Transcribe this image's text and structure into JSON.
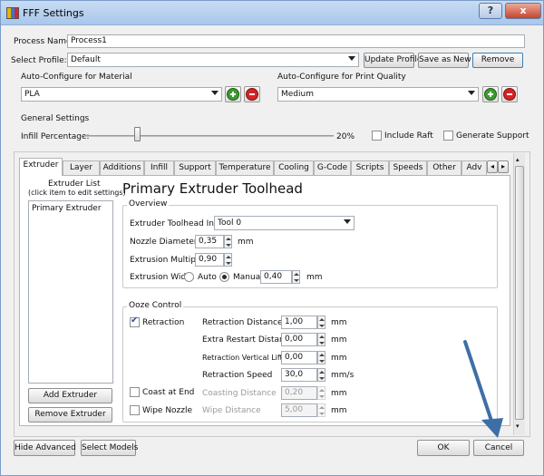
{
  "window": {
    "title": "FFF Settings",
    "help_label": "?",
    "close_label": "x"
  },
  "process_name_label": "Process Name:",
  "process_name_value": "Process1",
  "select_profile_label": "Select Profile:",
  "select_profile_value": "Default",
  "update_profile_label": "Update Profile",
  "save_as_new_label": "Save as New",
  "remove_label": "Remove",
  "auto_material_label": "Auto-Configure for Material",
  "auto_material_value": "PLA",
  "auto_quality_label": "Auto-Configure for Print Quality",
  "auto_quality_value": "Medium",
  "general_settings_label": "General Settings",
  "infill_percentage_label": "Infill Percentage:",
  "infill_percentage_value": "20%",
  "infill_percentage_fraction": 0.2,
  "include_raft_label": "Include Raft",
  "generate_support_label": "Generate Support",
  "tabs": [
    "Extruder",
    "Layer",
    "Additions",
    "Infill",
    "Support",
    "Temperature",
    "Cooling",
    "G-Code",
    "Scripts",
    "Speeds",
    "Other",
    "Adv"
  ],
  "active_tab": "Extruder",
  "extruder_list": {
    "title_line1": "Extruder List",
    "title_line2": "(click item to edit settings)",
    "items": [
      "Primary Extruder"
    ]
  },
  "add_extruder_label": "Add Extruder",
  "remove_extruder_label": "Remove Extruder",
  "panel_title": "Primary Extruder Toolhead",
  "overview": {
    "title": "Overview",
    "toolhead_index_label": "Extruder Toolhead Index",
    "toolhead_index_value": "Tool 0",
    "nozzle_diameter_label": "Nozzle Diameter",
    "nozzle_diameter_value": "0,35",
    "nozzle_diameter_unit": "mm",
    "extrusion_multiplier_label": "Extrusion Multiplier",
    "extrusion_multiplier_value": "0,90",
    "extrusion_width_label": "Extrusion Width",
    "auto_label": "Auto",
    "manual_label": "Manual",
    "extrusion_width_value": "0,40",
    "extrusion_width_unit": "mm"
  },
  "ooze": {
    "title": "Ooze Control",
    "retraction_label": "Retraction",
    "coast_label": "Coast at End",
    "wipe_label": "Wipe Nozzle",
    "rows": [
      {
        "label": "Retraction Distance",
        "value": "1,00",
        "unit": "mm",
        "disabled": false
      },
      {
        "label": "Extra Restart Distance",
        "value": "0,00",
        "unit": "mm",
        "disabled": false
      },
      {
        "label": "Retraction Vertical Lift",
        "value": "0,00",
        "unit": "mm",
        "disabled": false
      },
      {
        "label": "Retraction Speed",
        "value": "30,0",
        "unit": "mm/s",
        "disabled": false
      },
      {
        "label": "Coasting Distance",
        "value": "0,20",
        "unit": "mm",
        "disabled": true
      },
      {
        "label": "Wipe Distance",
        "value": "5,00",
        "unit": "mm",
        "disabled": true
      }
    ]
  },
  "hide_advanced_label": "Hide Advanced",
  "select_models_label": "Select Models",
  "ok_label": "OK",
  "cancel_label": "Cancel",
  "colors": {
    "annotation_arrow": "#3d6fa6",
    "accent": "#2a4fa8"
  }
}
